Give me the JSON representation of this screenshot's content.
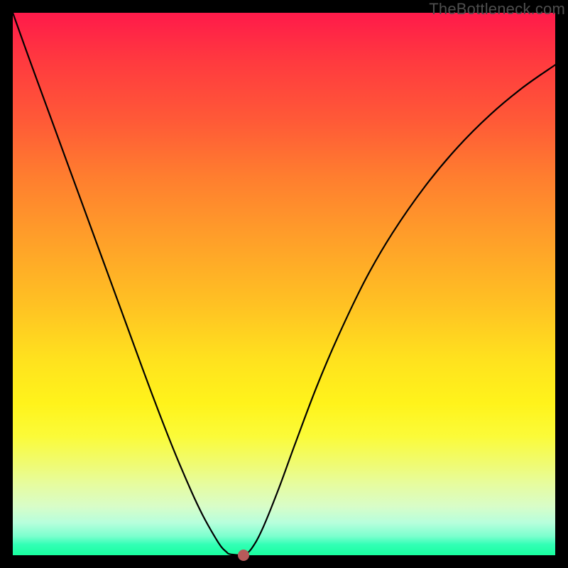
{
  "watermark": {
    "text": "TheBottleneck.com"
  },
  "colors": {
    "page_bg": "#000000",
    "curve": "#000000",
    "dot": "#b85a5a",
    "gradient_top": "#ff1a4a",
    "gradient_bottom": "#18ff9e"
  },
  "chart_data": {
    "type": "line",
    "title": "",
    "xlabel": "",
    "ylabel": "",
    "xlim": [
      0,
      1
    ],
    "ylim": [
      0,
      1
    ],
    "annotations": [],
    "series": [
      {
        "name": "curve",
        "x": [
          0.0,
          0.03,
          0.06,
          0.09,
          0.12,
          0.15,
          0.18,
          0.21,
          0.24,
          0.27,
          0.3,
          0.33,
          0.35,
          0.37,
          0.384,
          0.394,
          0.4,
          0.42,
          0.426,
          0.44,
          0.46,
          0.49,
          0.52,
          0.56,
          0.6,
          0.65,
          0.7,
          0.76,
          0.82,
          0.88,
          0.94,
          1.0
        ],
        "y": [
          1.0,
          0.916,
          0.834,
          0.752,
          0.67,
          0.588,
          0.506,
          0.424,
          0.342,
          0.262,
          0.186,
          0.116,
          0.074,
          0.038,
          0.016,
          0.006,
          0.002,
          0.0,
          0.0,
          0.012,
          0.048,
          0.122,
          0.204,
          0.31,
          0.404,
          0.508,
          0.594,
          0.68,
          0.752,
          0.812,
          0.862,
          0.904
        ]
      }
    ],
    "marker": {
      "x": 0.426,
      "y": 0.0
    },
    "grid": false,
    "legend": false
  }
}
